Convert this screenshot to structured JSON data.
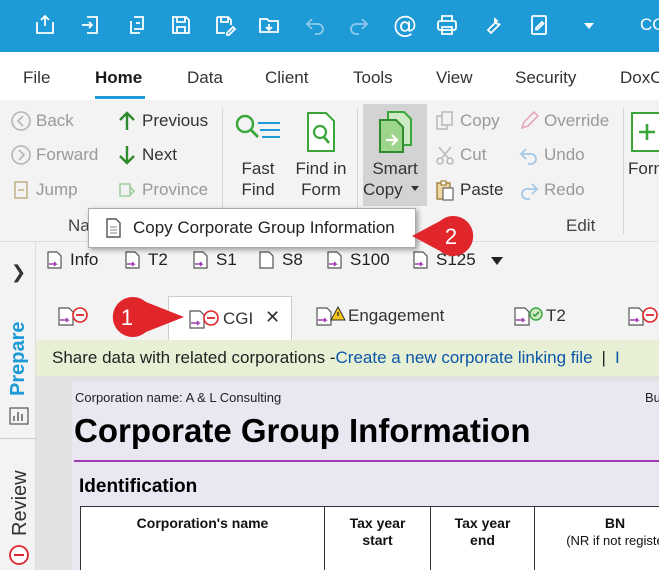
{
  "qat": {
    "icons": [
      "new-return-icon",
      "import-icon",
      "rollforward-icon",
      "save-icon",
      "save-as-icon",
      "open-folder-icon",
      "undo-icon",
      "redo-icon",
      "email-icon",
      "print-icon",
      "wrench-icon",
      "edit-note-icon",
      "qat-dropdown-icon"
    ],
    "title_fragment": "CG"
  },
  "menu": {
    "tabs": [
      "File",
      "Home",
      "Data",
      "Client",
      "Tools",
      "View",
      "Security",
      "DoxC"
    ],
    "active": "Home"
  },
  "ribbon": {
    "back": "Back",
    "forward": "Forward",
    "jump": "Jump",
    "previous": "Previous",
    "next": "Next",
    "province": "Province",
    "fast_find_1": "Fast",
    "fast_find_2": "Find",
    "find_in_form_1": "Find in",
    "find_in_form_2": "Form",
    "smart_copy_1": "Smart",
    "smart_copy_2": "Copy",
    "copy": "Copy",
    "cut": "Cut",
    "paste": "Paste",
    "override": "Override",
    "undo": "Undo",
    "redo": "Redo",
    "form_fragment": "Forn",
    "group_nav_fragment": "Na",
    "group_edit": "Edit"
  },
  "popup": {
    "item": "Copy Corporate Group Information"
  },
  "callouts": {
    "one": "1",
    "two": "2"
  },
  "sidebar": {
    "prepare": "Prepare",
    "review": "Review"
  },
  "forms_bar": {
    "items": [
      "Info",
      "T2",
      "S1",
      "S8",
      "S100",
      "S125"
    ]
  },
  "doc_tabs": {
    "active_label": "CGI",
    "engagement": "Engagement",
    "t2": "T2"
  },
  "link_bar": {
    "text": "Share data with related corporations - ",
    "link": "Create a new corporate linking file",
    "sep": "|"
  },
  "form": {
    "corp_label": "Corporation name: A & L Consulting",
    "bu_fragment": "Bu",
    "title": "Corporate Group Information",
    "section": "Identification",
    "col_name": "Corporation's name",
    "col_start_1": "Tax year",
    "col_start_2": "start",
    "col_end_1": "Tax year",
    "col_end_2": "end",
    "col_bn": "BN",
    "col_bn_sub": "(NR if not registe"
  },
  "colors": {
    "accent": "#1e9ad6",
    "callout_red": "#e0262b",
    "link_bar_bg": "#e7f0d5",
    "form_bg": "#eae6f2"
  }
}
